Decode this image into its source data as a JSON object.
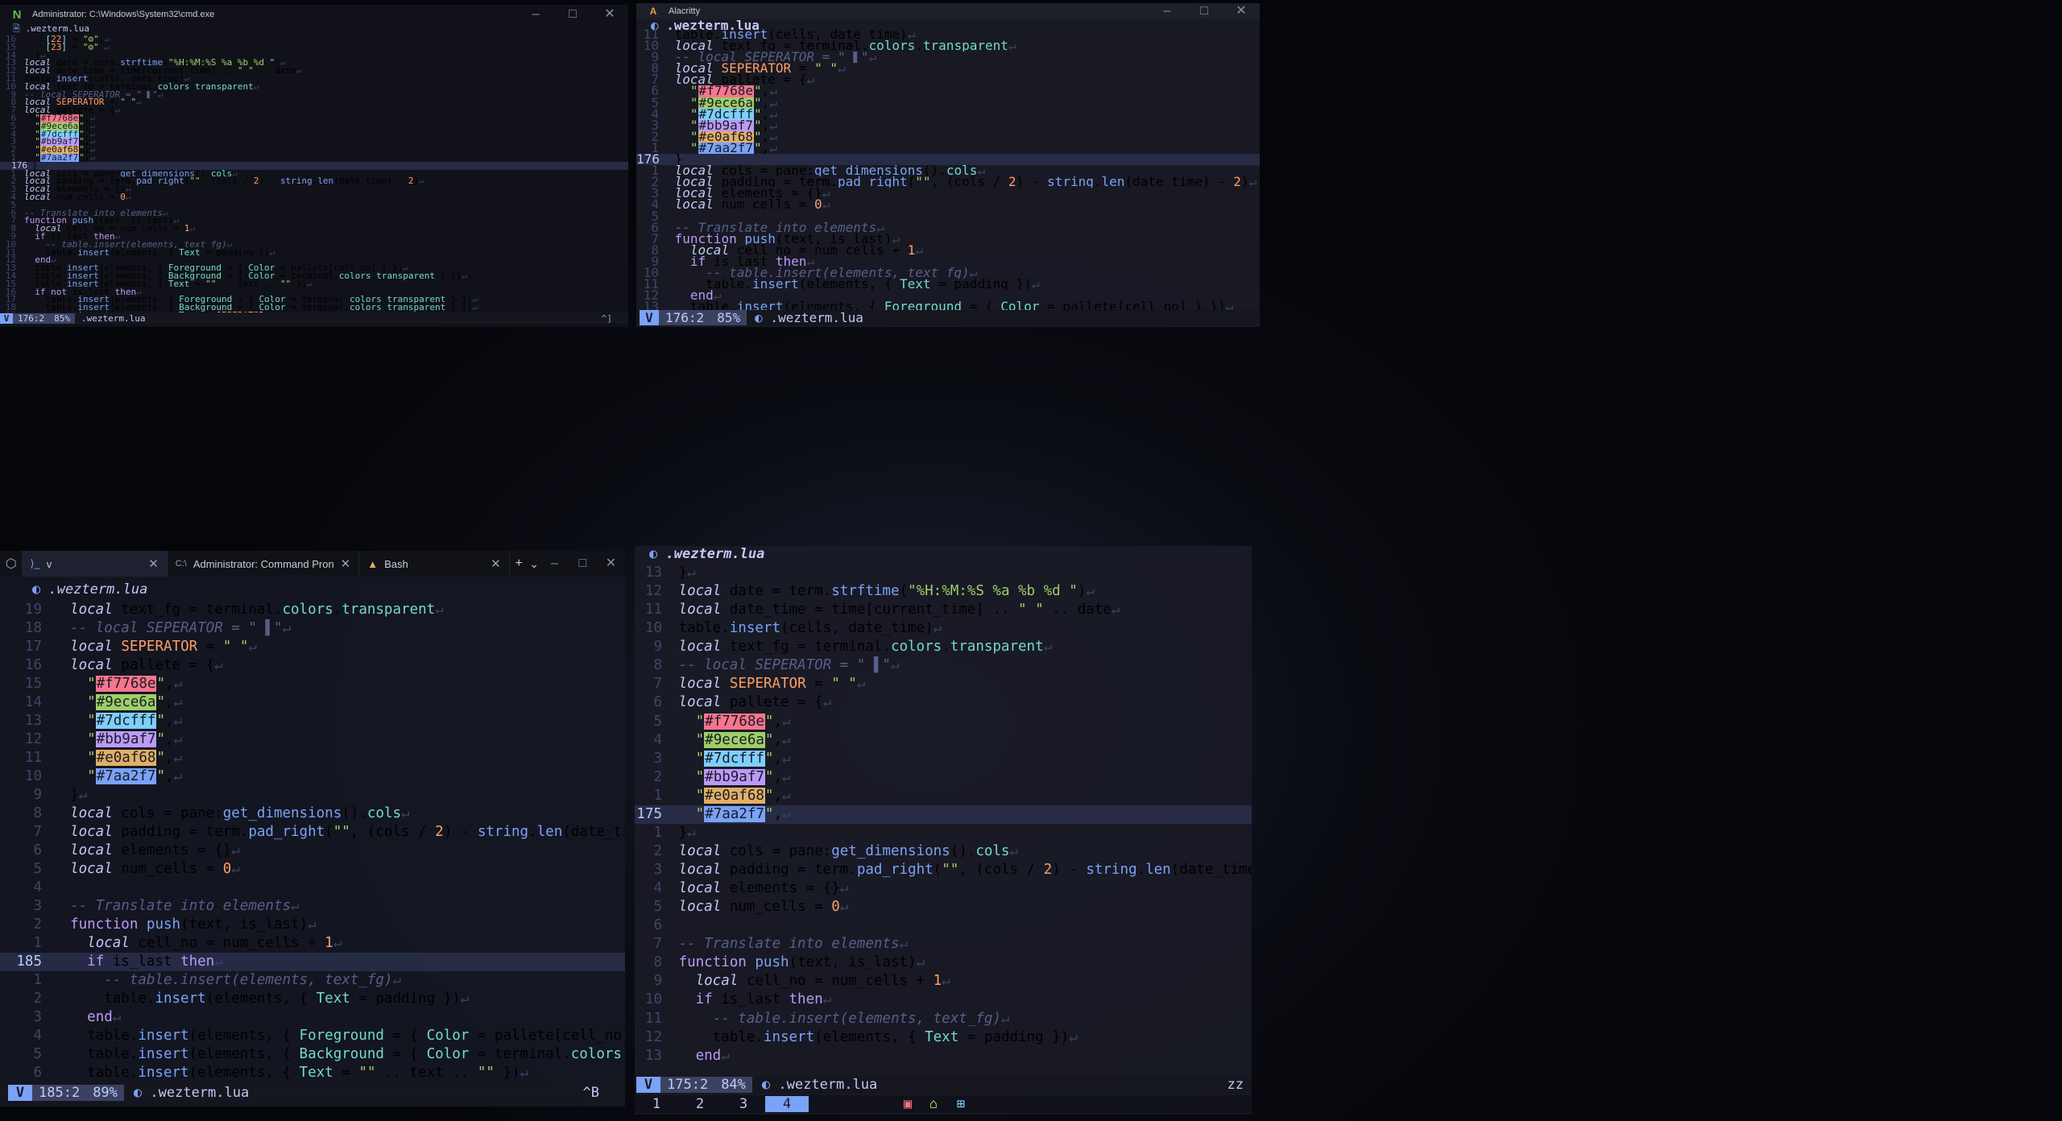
{
  "colors": {
    "bg": "#1a1b26",
    "fg": "#c0caf5",
    "accent": "#7aa2f7",
    "linenr": "#3e4668"
  },
  "win_cmd": {
    "title": "Administrator: C:\\Windows\\System32\\cmd.exe",
    "file": ".wezterm.lua",
    "status": {
      "mode": "V",
      "pos": "176:2",
      "pct": "85%",
      "file": ".wezterm.lua",
      "right": "^]"
    }
  },
  "win_alacritty": {
    "title": "Alacritty",
    "file": ".wezterm.lua",
    "status": {
      "mode": "V",
      "pos": "176:2",
      "pct": "85%",
      "file": ".wezterm.lua"
    }
  },
  "win_wezterm": {
    "tabs": [
      {
        "label": "v",
        "icon": "powershell-icon"
      },
      {
        "label": "Administrator: Command Pron",
        "icon": "cmd-icon"
      },
      {
        "label": "Bash",
        "icon": "arch-linux-icon"
      }
    ],
    "new_tab": "+",
    "dropdown": "⌄",
    "file": ".wezterm.lua",
    "status": {
      "mode": "V",
      "pos": "185:2",
      "pct": "89%",
      "file": ".wezterm.lua",
      "right": "^B"
    }
  },
  "win_tmux": {
    "file": ".wezterm.lua",
    "status": {
      "mode": "V",
      "pos": "175:2",
      "pct": "84%",
      "file": ".wezterm.lua",
      "right": "zz"
    },
    "windows": [
      "1",
      "2",
      "3",
      "4"
    ],
    "active_window": "4",
    "tray_icons": [
      "red-box-icon",
      "home-icon",
      "windows-icon"
    ]
  }
}
